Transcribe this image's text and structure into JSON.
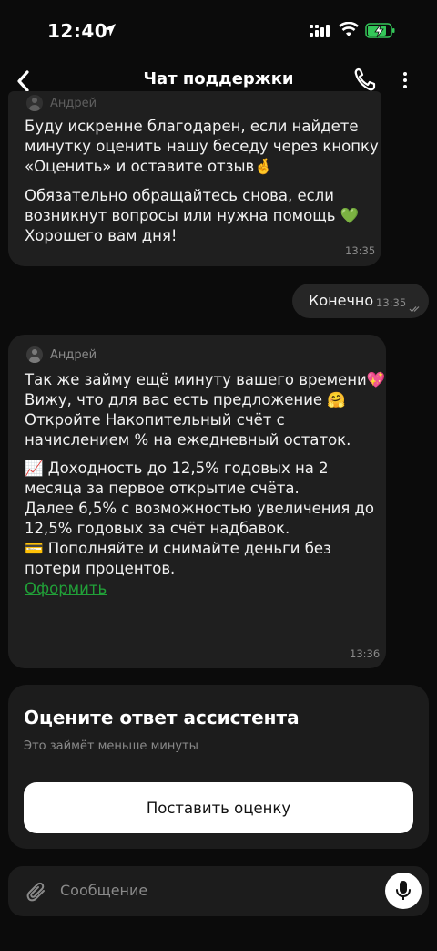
{
  "status_bar": {
    "time": "12:40"
  },
  "header": {
    "title": "Чат поддержки"
  },
  "messages": {
    "first": {
      "author": "Андрей",
      "paragraph1_lines": [
        "Буду искренне благодарен, если найдете",
        "минутку оценить нашу беседу через кнопку",
        "«Оценить» и оставите отзыв🤞"
      ],
      "paragraph2_lines": [
        "Обязательно обращайтесь снова, если",
        "возникнут вопросы или нужна помощь 💚",
        "Хорошего вам дня!"
      ],
      "time": "13:35"
    },
    "user": {
      "text": "Конечно",
      "time": "13:35"
    },
    "second": {
      "author": "Андрей",
      "paragraph1_lines": [
        "Так же займу ещё минуту вашего времени💖",
        "Вижу, что для вас есть предложение 🤗",
        "Откройте Накопительный счёт с",
        "начислением % на ежедневный остаток."
      ],
      "paragraph2_lines": [
        "📈 Доходность до 12,5% годовых на 2",
        "месяца за первое открытие счёта.",
        "Далее 6,5% с возможностью увеличения до",
        "12,5% годовых за счёт надбавок.",
        "💳 Пополняйте и снимайте деньги без",
        "потери процентов."
      ],
      "link": "Оформить",
      "time": "13:36"
    }
  },
  "rating": {
    "title": "Оцените ответ ассистента",
    "subtitle": "Это займёт меньше минуты",
    "button": "Поставить оценку"
  },
  "composer": {
    "placeholder": "Сообщение"
  },
  "colors": {
    "background": "#0b0b0b",
    "bubble": "#1f1f1f",
    "link": "#21a038",
    "battery": "#34c759"
  }
}
